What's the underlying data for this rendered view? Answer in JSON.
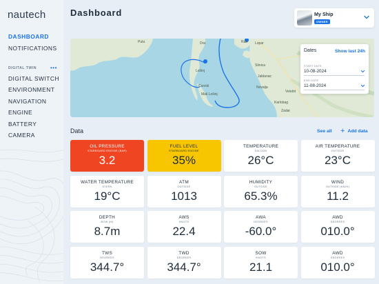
{
  "app": {
    "logo": "nautech"
  },
  "sidebar": {
    "primary": [
      {
        "label": "DASHBOARD",
        "active": true
      },
      {
        "label": "NOTIFICATIONS",
        "active": false
      }
    ],
    "section_label": "DIGITAL TWIN",
    "section_more": "•••",
    "secondary": [
      {
        "label": "DIGITAL SWITCH"
      },
      {
        "label": "ENVIRONMENT"
      },
      {
        "label": "NAVIGATION"
      },
      {
        "label": "ENGINE"
      },
      {
        "label": "BATTERY"
      },
      {
        "label": "CAMERA"
      }
    ]
  },
  "header": {
    "title": "Dashboard"
  },
  "ship_selector": {
    "name": "My Ship",
    "role": "OWNER"
  },
  "map": {
    "labels": [
      "Pula",
      "Dra",
      "Lopar",
      "Rab",
      "Lošinj",
      "Cunski",
      "Mali Lošinj",
      "Stinica",
      "Jablanac",
      "Novalja",
      "Velebit",
      "Karlobag",
      "Zadar"
    ]
  },
  "dates": {
    "title": "Dates",
    "quick_link": "Show last 24h",
    "start_label": "START DATE",
    "start_value": "10-08-2024",
    "end_label": "END DATE",
    "end_value": "11-08-2024"
  },
  "data_section": {
    "title": "Data",
    "see_all": "See all",
    "add_data": "Add data"
  },
  "tiles": [
    {
      "label": "OIL PRESSURE",
      "sub": "STARBOARD ENGINE (BAR)",
      "value": "3.2",
      "status": "alarm"
    },
    {
      "label": "FUEL LEVEL",
      "sub": "STARBOARD ENGINE",
      "value": "35%",
      "status": "warning"
    },
    {
      "label": "TEMPERATURE",
      "sub": "SALOON",
      "value": "26°C",
      "status": "normal"
    },
    {
      "label": "AIR TEMPERATURE",
      "sub": "OUTSIDE",
      "value": "23°C",
      "status": "normal"
    },
    {
      "label": "WATER TEMPERATURE",
      "sub": "STERN",
      "value": "19°C",
      "status": "normal"
    },
    {
      "label": "ATM",
      "sub": "OUTSIDE",
      "value": "1013",
      "status": "normal"
    },
    {
      "label": "HUMIDITY",
      "sub": "OUTSIDE",
      "value": "65.3%",
      "status": "normal"
    },
    {
      "label": "WIND",
      "sub": "OUTSIDE (KM/H)",
      "value": "11.2",
      "status": "normal"
    },
    {
      "label": "DEPTH",
      "sub": "BOW (M)",
      "value": "8.7m",
      "status": "normal"
    },
    {
      "label": "AWS",
      "sub": "KNOTS",
      "value": "22.4",
      "status": "normal"
    },
    {
      "label": "AWA",
      "sub": "DEGREES",
      "value": "-60.0°",
      "status": "normal"
    },
    {
      "label": "AWD",
      "sub": "DEGREES",
      "value": "010.0°",
      "status": "normal"
    },
    {
      "label": "TWS",
      "sub": "DEGREES",
      "value": "344.7°",
      "status": "normal"
    },
    {
      "label": "TWD",
      "sub": "DEGREES",
      "value": "344.7°",
      "status": "normal"
    },
    {
      "label": "SOW",
      "sub": "KNOTS",
      "value": "21.1",
      "status": "normal"
    },
    {
      "label": "AWD",
      "sub": "DEGREES",
      "value": "010.0°",
      "status": "normal"
    }
  ],
  "colors": {
    "accent": "#1a73e8",
    "alarm": "#ef4523",
    "warning": "#f7c600",
    "background": "#e7eef5",
    "sea": "#a9d6e4",
    "land": "#dfe9d6"
  }
}
